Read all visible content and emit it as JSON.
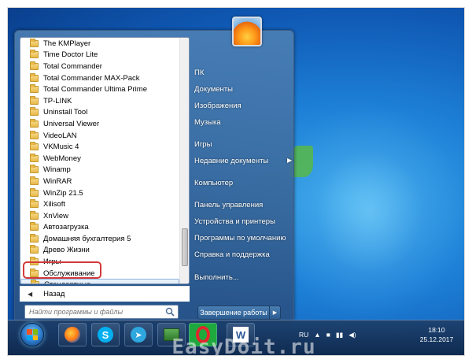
{
  "programs": [
    "The KMPlayer",
    "Time Doctor Lite",
    "Total Commander",
    "Total Commander MAX-Pack",
    "Total Commander Ultima Prime",
    "TP-LINK",
    "Uninstall Tool",
    "Universal Viewer",
    "VideoLAN",
    "VKMusic 4",
    "WebMoney",
    "Winamp",
    "WinRAR",
    "WinZip 21.5",
    "Xilisoft",
    "XnView",
    "Автозагрузка",
    "Домашняя бухгалтерия 5",
    "Древо Жизни",
    "Игры",
    "Обслуживание",
    "Стандартные"
  ],
  "back_label": "Назад",
  "search_placeholder": "Найти программы и файлы",
  "right_items": [
    "ПК",
    "Документы",
    "Изображения",
    "Музыка",
    "Игры",
    "Недавние документы",
    "Компьютер",
    "Панель управления",
    "Устройства и принтеры",
    "Программы по умолчанию",
    "Справка и поддержка",
    "Выполнить..."
  ],
  "shutdown_label": "Завершение работы",
  "tray": {
    "lang": "RU"
  },
  "clock": {
    "time": "18:10",
    "date": "25.12.2017"
  },
  "watermark": "EasyDoit.ru",
  "colors": {
    "highlight_ring": "#d33a3a",
    "desktop": "#1d7fd6"
  }
}
